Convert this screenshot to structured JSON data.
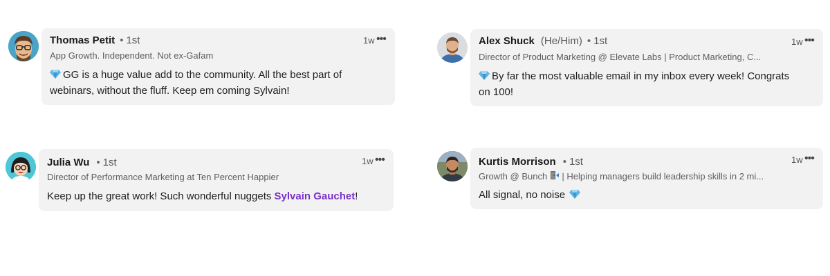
{
  "comments": [
    {
      "name": "Thomas Petit",
      "pronouns": "",
      "dot": "•",
      "degree": "1st",
      "headline": "App Growth. Independent. Not ex-Gafam",
      "time": "1w",
      "more": "•••",
      "text": "GG is a huge value add to the community. All the best part of webinars, without the fluff. Keep em coming Sylvain!",
      "avatar_icon": "cartoon-avatar-icon"
    },
    {
      "name": "Alex Shuck",
      "pronouns": "(He/Him)",
      "dot": "•",
      "degree": "1st",
      "headline": "Director of Product Marketing @ Elevate Labs | Product Marketing, C...",
      "time": "1w",
      "more": "•••",
      "text": "By far the most valuable email in my inbox every week! Congrats on 100!",
      "avatar_icon": "photo-avatar-icon"
    },
    {
      "name": "Julia Wu",
      "pronouns": "",
      "dot": "•",
      "degree": "1st",
      "headline": "Director of Performance Marketing at Ten Percent Happier",
      "time": "1w",
      "more": "•••",
      "text_before": "Keep up the great work! Such wonderful nuggets ",
      "mention": "Sylvain Gauchet",
      "text_after": "!",
      "avatar_icon": "illustrated-avatar-icon"
    },
    {
      "name": "Kurtis Morrison",
      "pronouns": "",
      "dot": "•",
      "degree": "1st",
      "headline_before": "Growth @ Bunch ",
      "headline_after": " | Helping managers build leadership skills in 2 mi...",
      "time": "1w",
      "more": "•••",
      "text": "All signal, no noise",
      "avatar_icon": "photo-avatar-icon"
    }
  ],
  "colors": {
    "bubble": "#f2f2f2",
    "mention": "#7a33c9",
    "diamond": "#5ab6e8"
  }
}
